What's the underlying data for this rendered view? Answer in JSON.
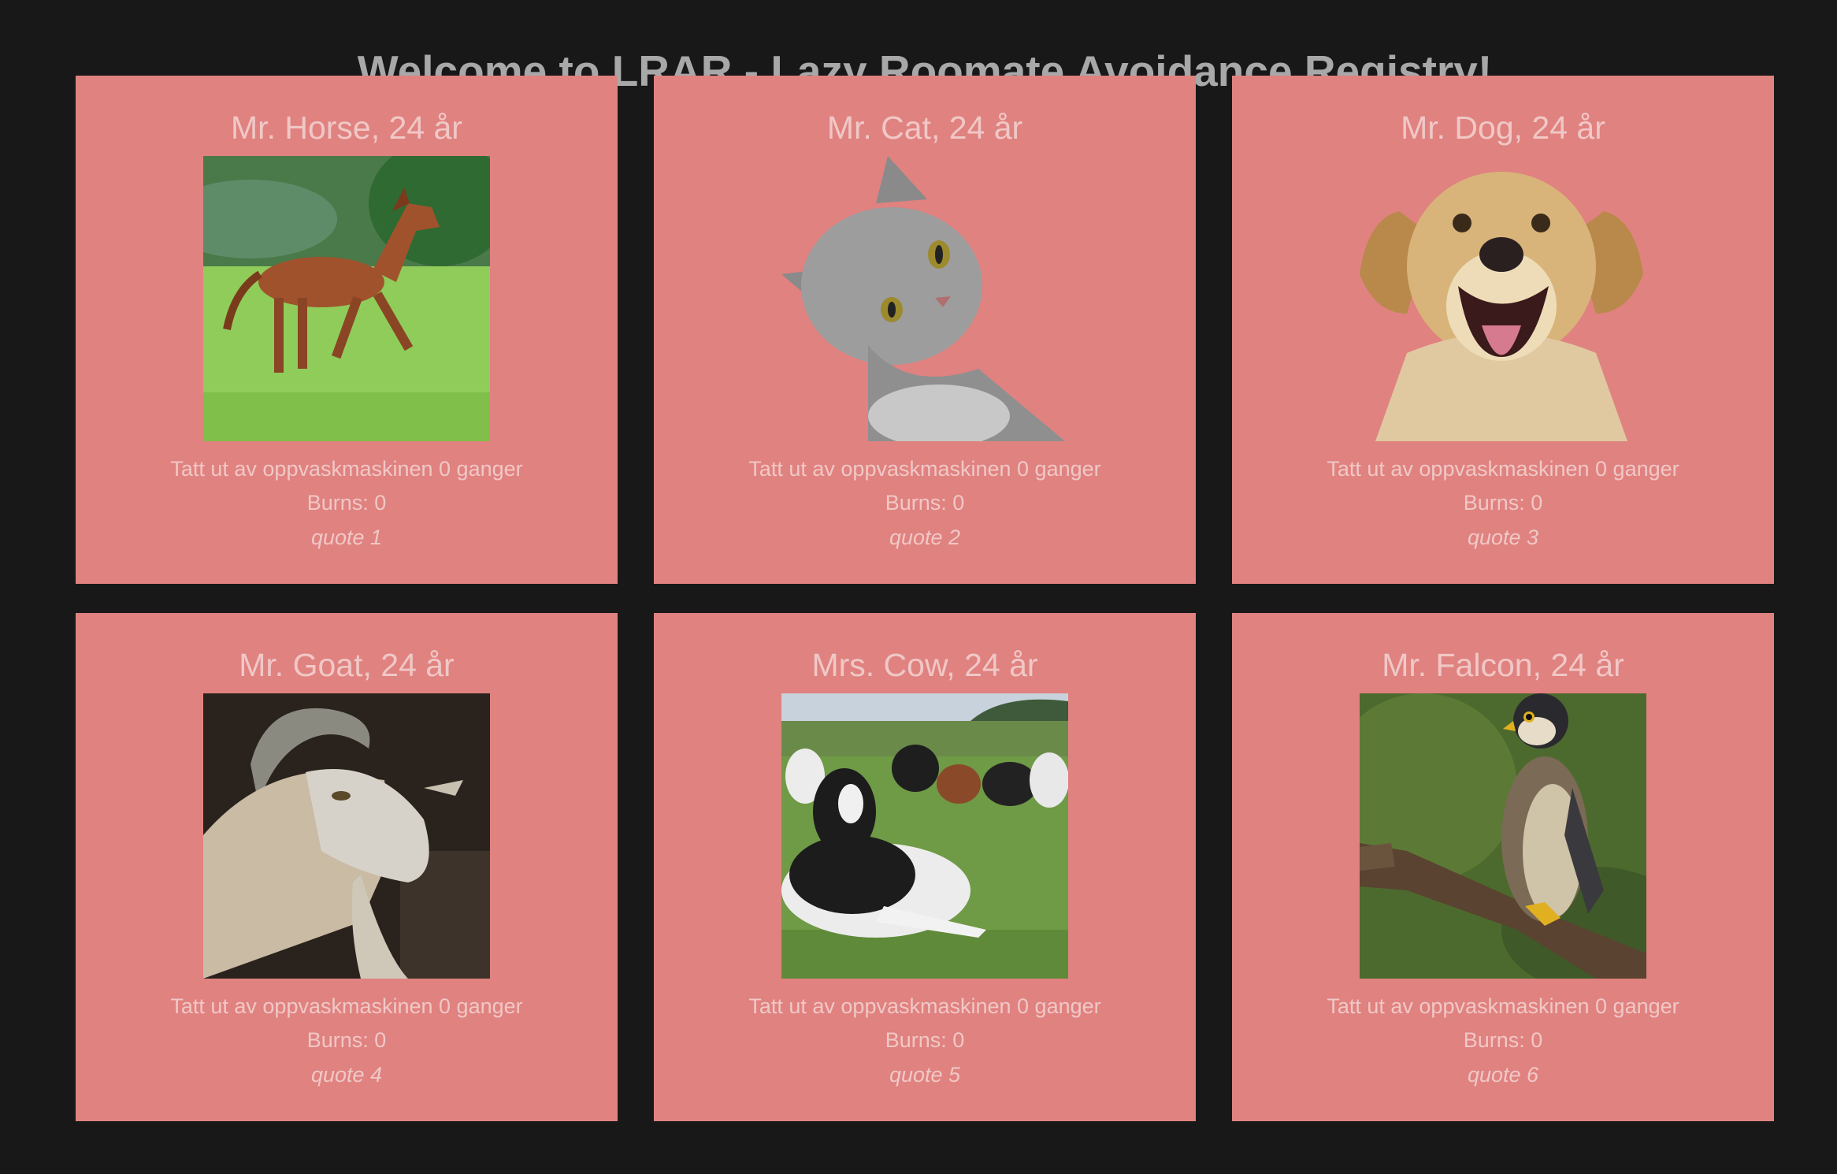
{
  "page": {
    "title": "Welcome to LRAR - Lazy Roomate Avoidance Registry!"
  },
  "colors": {
    "background": "#181818",
    "card": "#e08280",
    "card_text": "#f0c8c6",
    "title_text": "#a8a8a8"
  },
  "cards": [
    {
      "name": "Mr. Horse, 24 år",
      "photo": "horse-photo",
      "dishwasher": "Tatt ut av oppvaskmaskinen 0 ganger",
      "burns": "Burns: 0",
      "quote": "quote 1"
    },
    {
      "name": "Mr. Cat, 24 år",
      "photo": "cat-photo",
      "dishwasher": "Tatt ut av oppvaskmaskinen 0 ganger",
      "burns": "Burns: 0",
      "quote": "quote 2"
    },
    {
      "name": "Mr. Dog, 24 år",
      "photo": "dog-photo",
      "dishwasher": "Tatt ut av oppvaskmaskinen 0 ganger",
      "burns": "Burns: 0",
      "quote": "quote 3"
    },
    {
      "name": "Mr. Goat, 24 år",
      "photo": "goat-photo",
      "dishwasher": "Tatt ut av oppvaskmaskinen 0 ganger",
      "burns": "Burns: 0",
      "quote": "quote 4"
    },
    {
      "name": "Mrs. Cow, 24 år",
      "photo": "cow-photo",
      "dishwasher": "Tatt ut av oppvaskmaskinen 0 ganger",
      "burns": "Burns: 0",
      "quote": "quote 5"
    },
    {
      "name": "Mr. Falcon, 24 år",
      "photo": "falcon-photo",
      "dishwasher": "Tatt ut av oppvaskmaskinen 0 ganger",
      "burns": "Burns: 0",
      "quote": "quote 6"
    }
  ]
}
